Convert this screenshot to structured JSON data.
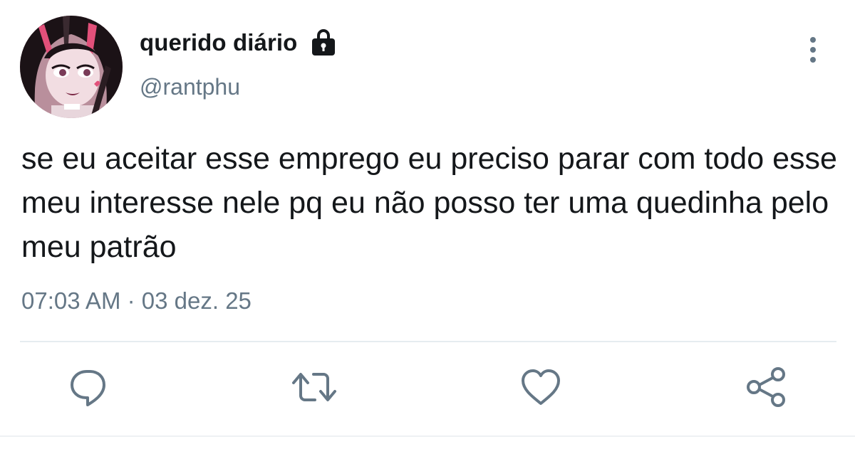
{
  "tweet": {
    "display_name": "querido diário",
    "handle": "@rantphu",
    "text": "se eu aceitar esse emprego eu preciso parar com todo esse meu interesse nele pq eu não posso ter uma quedinha pelo meu patrão",
    "time": "07:03 AM",
    "separator": "·",
    "date": "03 dez. 25",
    "protected": true
  },
  "icons": {
    "lock": "lock-icon",
    "more": "vertical-ellipsis-icon",
    "reply": "speech-bubble-icon",
    "retweet": "retweet-icon",
    "like": "heart-icon",
    "share": "share-icon"
  },
  "colors": {
    "text": "#14171a",
    "secondary": "#657786",
    "divider": "#e6ecf0"
  }
}
